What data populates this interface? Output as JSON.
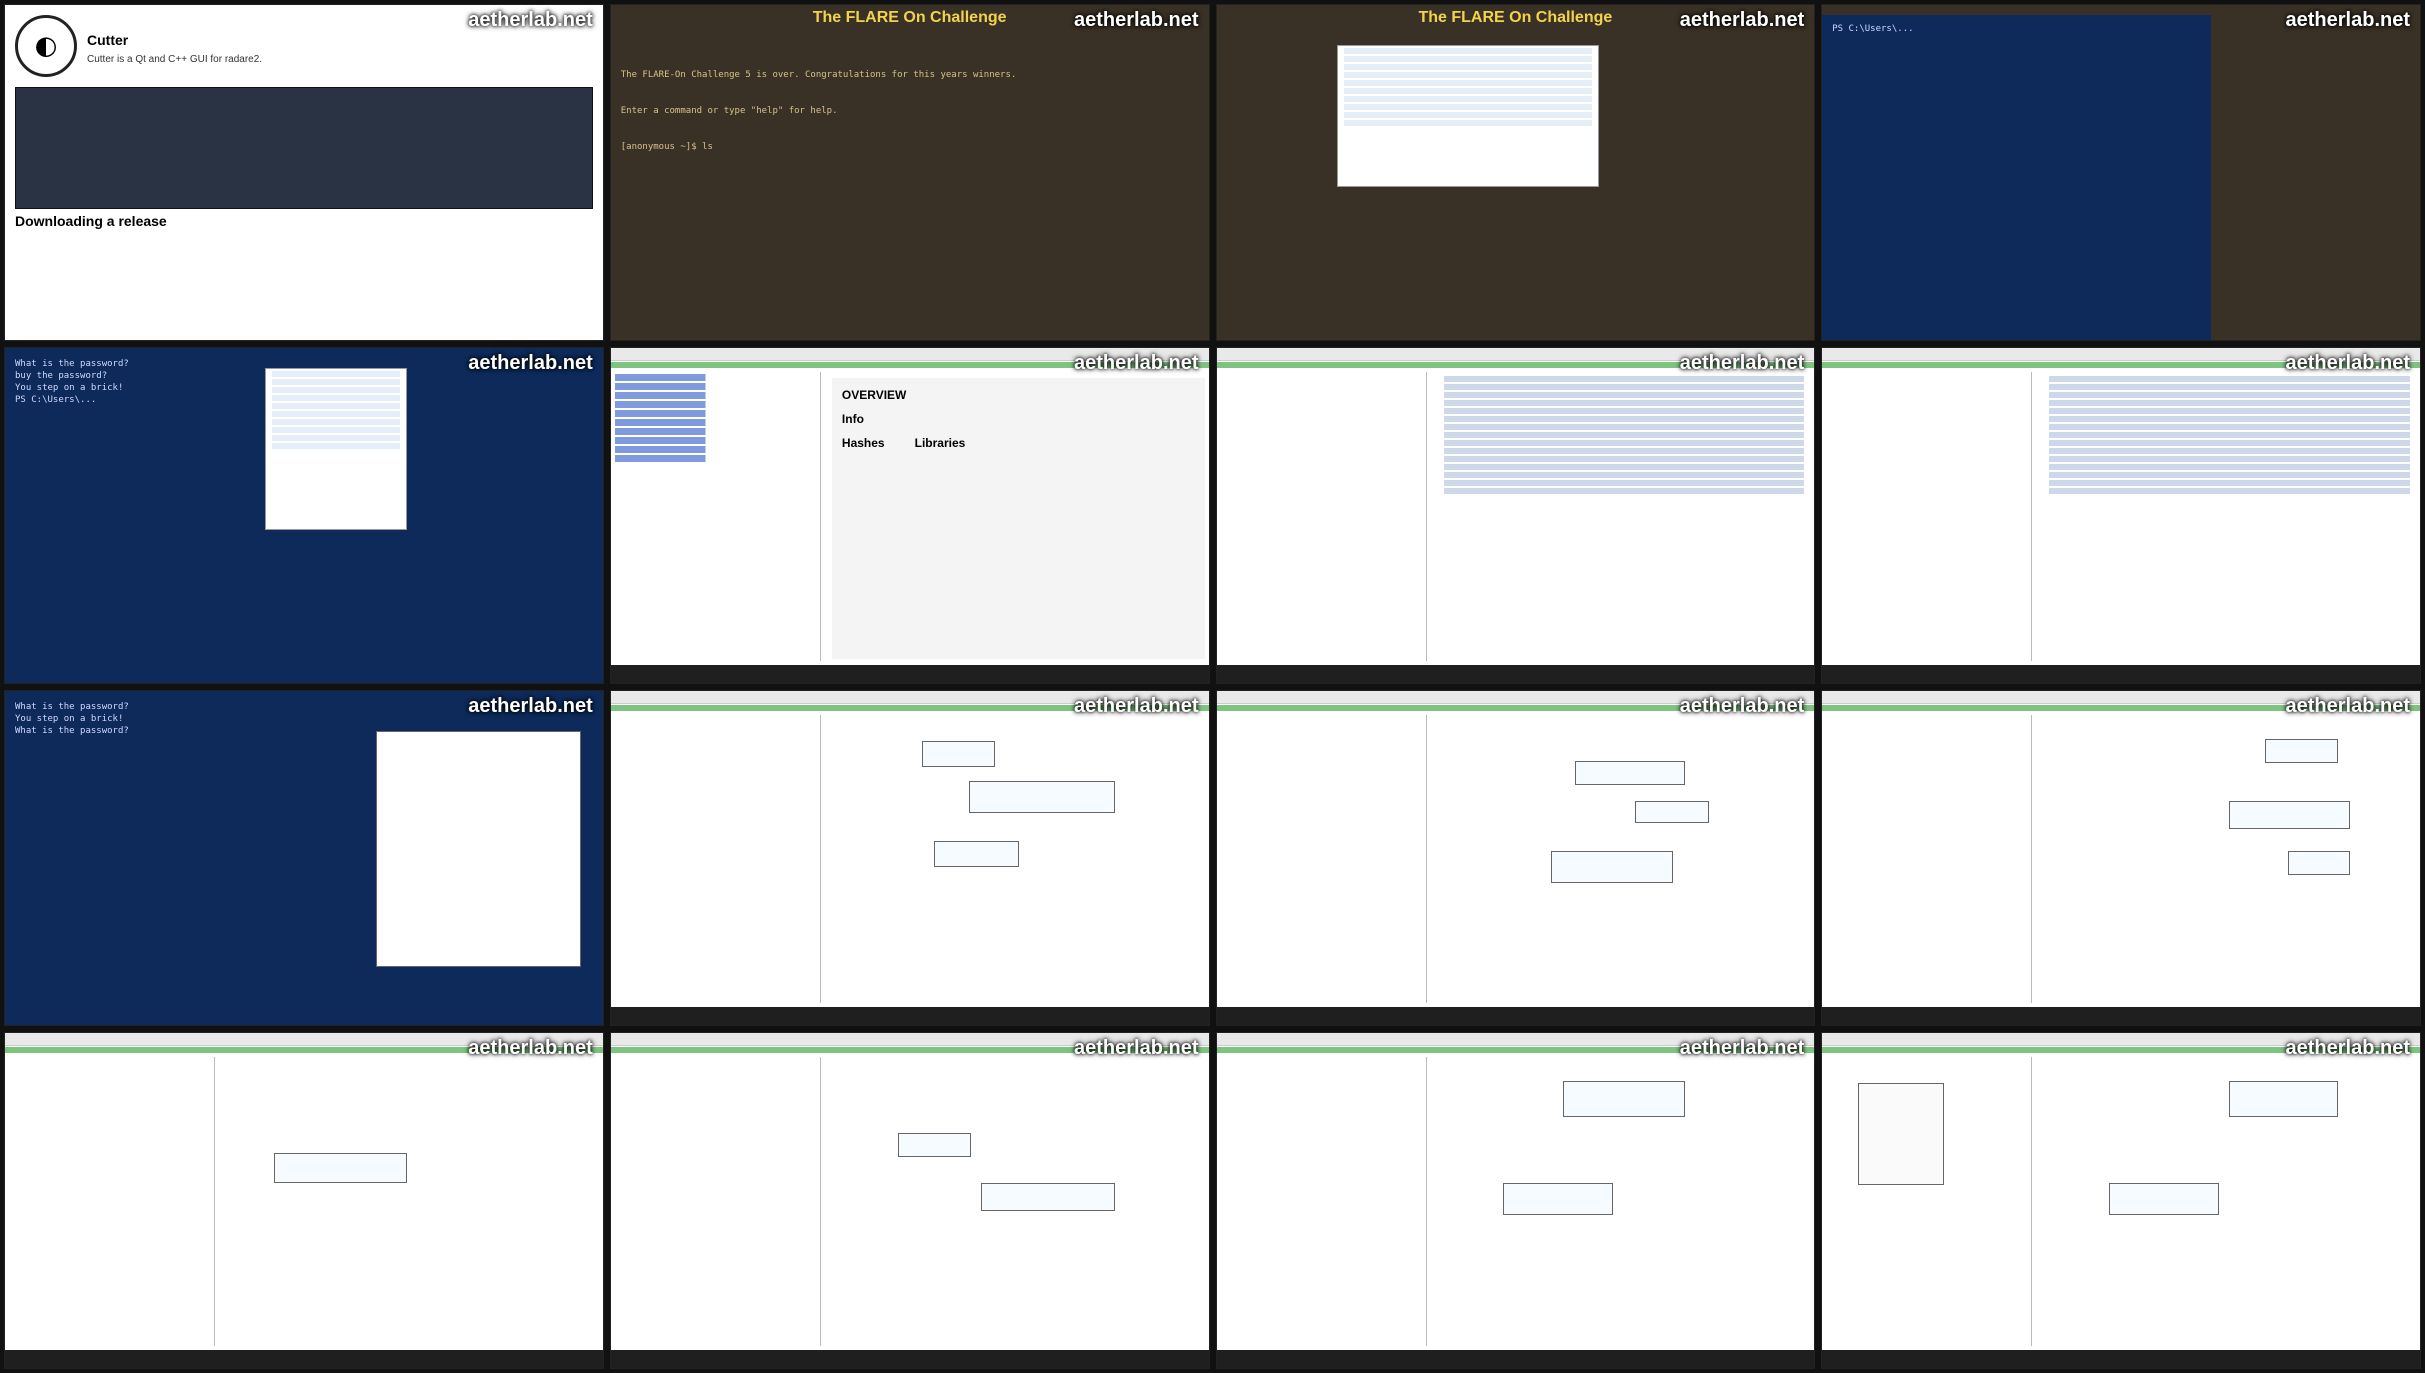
{
  "watermark": "aetherlab.net",
  "tiles": [
    {
      "id": "t1",
      "kind": "doc",
      "title": "Cutter",
      "subtitle": "Downloading a release"
    },
    {
      "id": "t2",
      "kind": "terminal-brown",
      "banner": "The FLARE On Challenge",
      "line1": "The FLARE-On Challenge 5 is over. Congratulations for this years winners.",
      "line2": "Enter a command or type \"help\" for help.",
      "prompt": "[anonymous ~]$ ls"
    },
    {
      "id": "t3",
      "kind": "terminal-brown-explorer",
      "banner": "The FLARE On Challenge"
    },
    {
      "id": "t4",
      "kind": "blue-terminal",
      "text": "PS C:\\Users\\..."
    },
    {
      "id": "t5",
      "kind": "ps-explorer",
      "text": "What is the password?\nbuy the password?\nYou step on a brick!\nPS C:\\Users\\..."
    },
    {
      "id": "t6",
      "kind": "cutter-overview",
      "overview": "OVERVIEW",
      "info": "Info",
      "hashes": "Hashes",
      "libraries": "Libraries"
    },
    {
      "id": "t7",
      "kind": "cutter-code"
    },
    {
      "id": "t8",
      "kind": "cutter-code"
    },
    {
      "id": "t9",
      "kind": "ps-graph",
      "text": "What is the password?\nYou step on a brick!\nWhat is the password?"
    },
    {
      "id": "t10",
      "kind": "cutter-graph"
    },
    {
      "id": "t11",
      "kind": "cutter-graph"
    },
    {
      "id": "t12",
      "kind": "cutter-graph"
    },
    {
      "id": "t13",
      "kind": "cutter-graph-small"
    },
    {
      "id": "t14",
      "kind": "cutter-graph-small"
    },
    {
      "id": "t15",
      "kind": "cutter-graph"
    },
    {
      "id": "t16",
      "kind": "cutter-graph-menu"
    }
  ]
}
